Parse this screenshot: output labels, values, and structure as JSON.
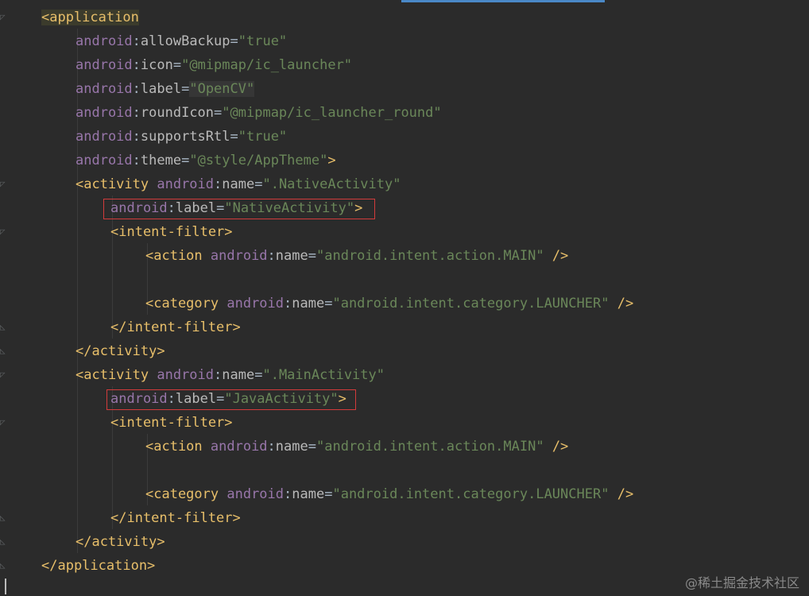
{
  "editor": {
    "lines": [
      {
        "indent": 52,
        "parts": [
          [
            "tag",
            "<application"
          ]
        ],
        "hl": true
      },
      {
        "indent": 95,
        "parts": [
          [
            "ns",
            "android"
          ],
          [
            "punct",
            ":"
          ],
          [
            "attr",
            "allowBackup"
          ],
          [
            "punct",
            "="
          ],
          [
            "val",
            "\"true\""
          ]
        ]
      },
      {
        "indent": 95,
        "parts": [
          [
            "ns",
            "android"
          ],
          [
            "punct",
            ":"
          ],
          [
            "attr",
            "icon"
          ],
          [
            "punct",
            "="
          ],
          [
            "val",
            "\"@mipmap/ic_launcher\""
          ]
        ]
      },
      {
        "indent": 95,
        "parts": [
          [
            "ns",
            "android"
          ],
          [
            "punct",
            ":"
          ],
          [
            "attr",
            "label"
          ],
          [
            "punct",
            "="
          ],
          [
            "valhl",
            "\"OpenCV\""
          ]
        ]
      },
      {
        "indent": 95,
        "parts": [
          [
            "ns",
            "android"
          ],
          [
            "punct",
            ":"
          ],
          [
            "attr",
            "roundIcon"
          ],
          [
            "punct",
            "="
          ],
          [
            "val",
            "\"@mipmap/ic_launcher_round\""
          ]
        ]
      },
      {
        "indent": 95,
        "parts": [
          [
            "ns",
            "android"
          ],
          [
            "punct",
            ":"
          ],
          [
            "attr",
            "supportsRtl"
          ],
          [
            "punct",
            "="
          ],
          [
            "val",
            "\"true\""
          ]
        ]
      },
      {
        "indent": 95,
        "parts": [
          [
            "ns",
            "android"
          ],
          [
            "punct",
            ":"
          ],
          [
            "attr",
            "theme"
          ],
          [
            "punct",
            "="
          ],
          [
            "val",
            "\"@style/AppTheme\""
          ],
          [
            "tag",
            ">"
          ]
        ]
      },
      {
        "indent": 95,
        "parts": [
          [
            "tag",
            "<activity "
          ],
          [
            "ns",
            "android"
          ],
          [
            "punct",
            ":"
          ],
          [
            "attr",
            "name"
          ],
          [
            "punct",
            "="
          ],
          [
            "val",
            "\".NativeActivity\""
          ]
        ]
      },
      {
        "indent": 139,
        "parts": [
          [
            "ns",
            "android"
          ],
          [
            "punct",
            ":"
          ],
          [
            "attr",
            "label"
          ],
          [
            "punct",
            "="
          ],
          [
            "val",
            "\"NativeActivity\""
          ],
          [
            "tag",
            ">"
          ]
        ]
      },
      {
        "indent": 139,
        "parts": [
          [
            "tag",
            "<intent-filter>"
          ]
        ]
      },
      {
        "indent": 183,
        "parts": [
          [
            "tag",
            "<action "
          ],
          [
            "ns",
            "android"
          ],
          [
            "punct",
            ":"
          ],
          [
            "attr",
            "name"
          ],
          [
            "punct",
            "="
          ],
          [
            "val",
            "\"android.intent.action.MAIN\""
          ],
          [
            "tag",
            " />"
          ]
        ]
      },
      {
        "indent": 183,
        "parts": []
      },
      {
        "indent": 183,
        "parts": [
          [
            "tag",
            "<category "
          ],
          [
            "ns",
            "android"
          ],
          [
            "punct",
            ":"
          ],
          [
            "attr",
            "name"
          ],
          [
            "punct",
            "="
          ],
          [
            "val",
            "\"android.intent.category.LAUNCHER\""
          ],
          [
            "tag",
            " />"
          ]
        ]
      },
      {
        "indent": 139,
        "parts": [
          [
            "tag",
            "</intent-filter>"
          ]
        ]
      },
      {
        "indent": 95,
        "parts": [
          [
            "tag",
            "</activity>"
          ]
        ]
      },
      {
        "indent": 95,
        "parts": [
          [
            "tag",
            "<activity "
          ],
          [
            "ns",
            "android"
          ],
          [
            "punct",
            ":"
          ],
          [
            "attr",
            "name"
          ],
          [
            "punct",
            "="
          ],
          [
            "val",
            "\".MainActivity\""
          ]
        ]
      },
      {
        "indent": 139,
        "parts": [
          [
            "ns",
            "android"
          ],
          [
            "punct",
            ":"
          ],
          [
            "attr",
            "label"
          ],
          [
            "punct",
            "="
          ],
          [
            "val",
            "\"JavaActivity\""
          ],
          [
            "tag",
            ">"
          ]
        ]
      },
      {
        "indent": 139,
        "parts": [
          [
            "tag",
            "<intent-filter>"
          ]
        ]
      },
      {
        "indent": 183,
        "parts": [
          [
            "tag",
            "<action "
          ],
          [
            "ns",
            "android"
          ],
          [
            "punct",
            ":"
          ],
          [
            "attr",
            "name"
          ],
          [
            "punct",
            "="
          ],
          [
            "val",
            "\"android.intent.action.MAIN\""
          ],
          [
            "tag",
            " />"
          ]
        ]
      },
      {
        "indent": 183,
        "parts": []
      },
      {
        "indent": 183,
        "parts": [
          [
            "tag",
            "<category "
          ],
          [
            "ns",
            "android"
          ],
          [
            "punct",
            ":"
          ],
          [
            "attr",
            "name"
          ],
          [
            "punct",
            "="
          ],
          [
            "val",
            "\"android.intent.category.LAUNCHER\""
          ],
          [
            "tag",
            " />"
          ]
        ]
      },
      {
        "indent": 139,
        "parts": [
          [
            "tag",
            "</intent-filter>"
          ]
        ]
      },
      {
        "indent": 95,
        "parts": [
          [
            "tag",
            "</activity>"
          ]
        ]
      },
      {
        "indent": 52,
        "parts": [
          [
            "tag",
            "</application>"
          ]
        ]
      }
    ]
  },
  "watermark": "@稀土掘金技术社区",
  "colors": {
    "background": "#2b2b2b",
    "tag": "#e8bf6a",
    "namespace": "#9876aa",
    "value": "#6a8759",
    "highlight_box": "#d23b3b",
    "accent": "#4a88c7"
  }
}
